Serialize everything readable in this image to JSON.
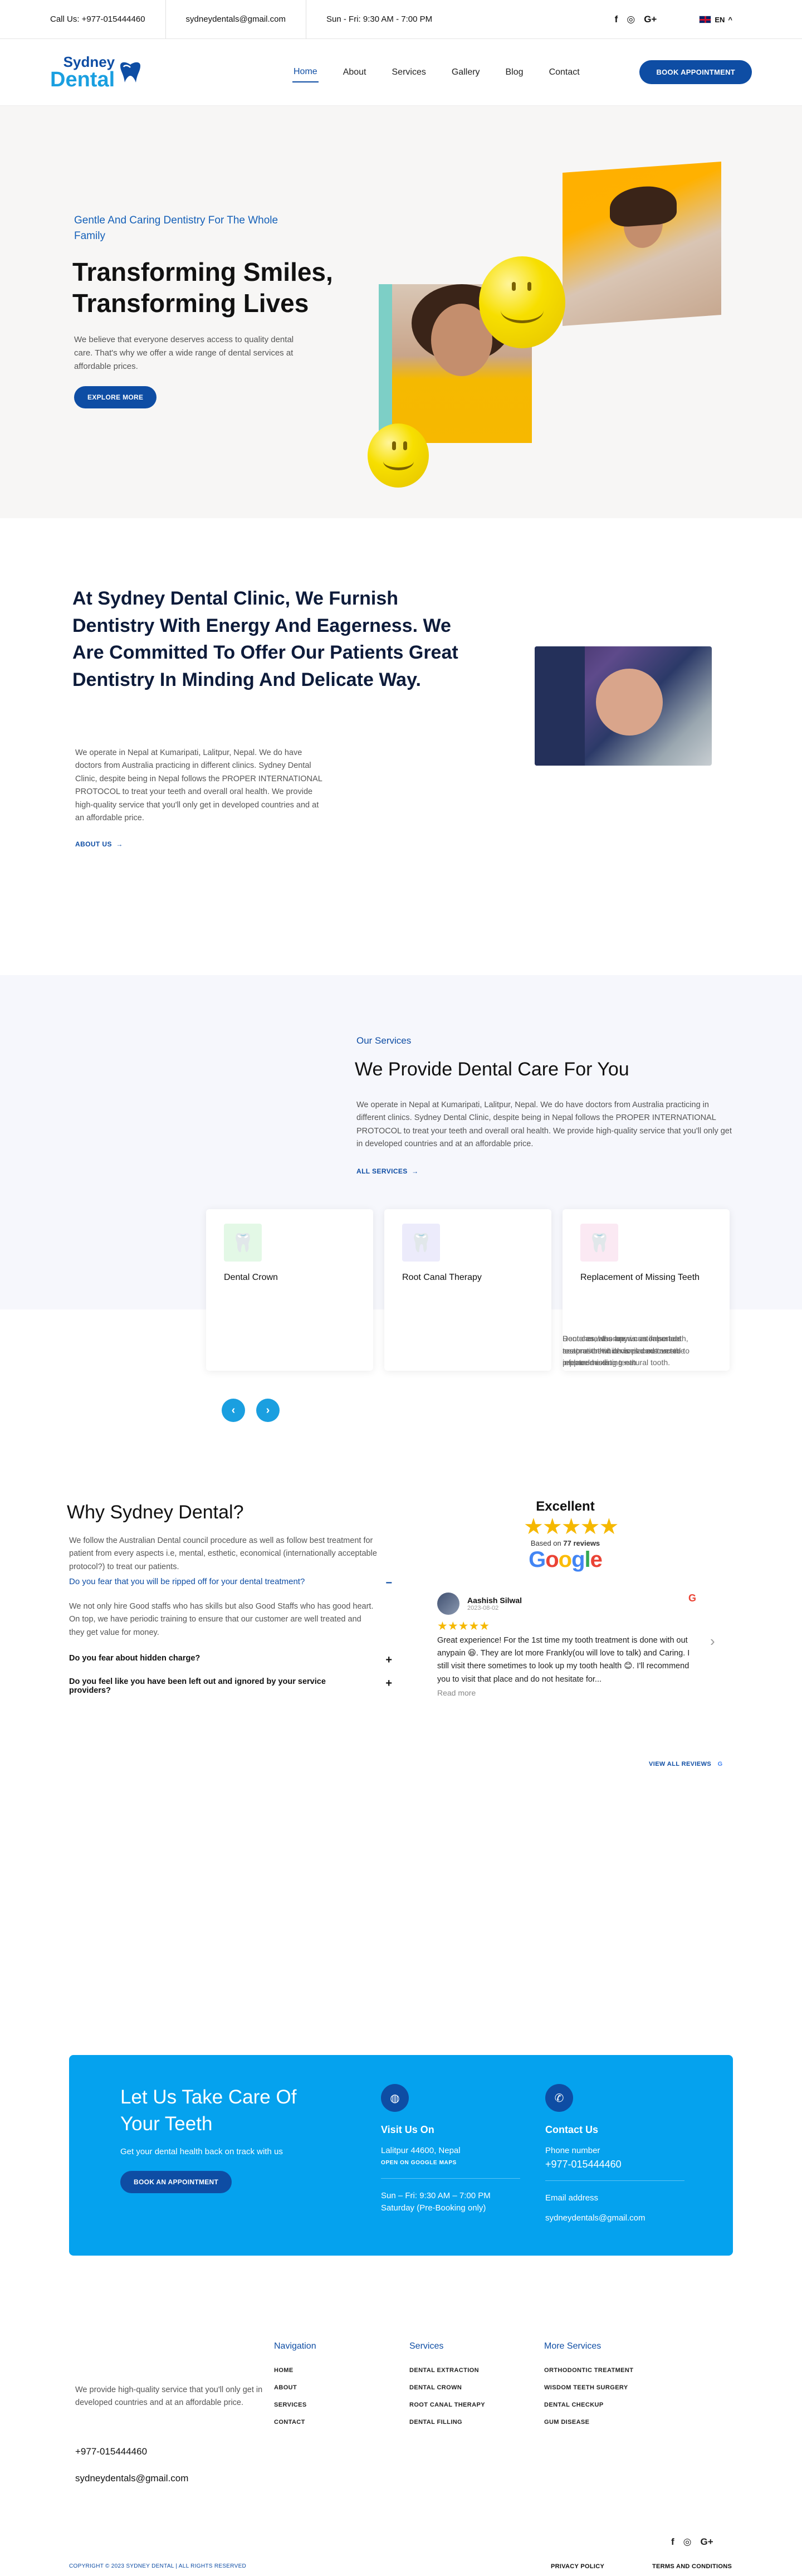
{
  "topbar": {
    "call": "Call Us: +977-015444460",
    "email": "sydneydentals@gmail.com",
    "hours": "Sun - Fri: 9:30 AM - 7:00 PM",
    "social": [
      "f",
      "◎",
      "G+"
    ],
    "language": "EN"
  },
  "header": {
    "logo_line1": "Sydney",
    "logo_line2": "Dental",
    "nav": [
      "Home",
      "About",
      "Services",
      "Gallery",
      "Blog",
      "Contact"
    ],
    "book_button": "BOOK APPOINTMENT"
  },
  "hero": {
    "tagline": "Gentle And Caring Dentistry For The Whole Family",
    "title": "Transforming Smiles, Transforming Lives",
    "description": "We believe that everyone deserves access to quality dental care. That's why we offer a wide range of dental services at affordable prices.",
    "button": "EXPLORE MORE"
  },
  "about": {
    "title": "At Sydney Dental Clinic, We Furnish Dentistry With Energy And Eagerness. We Are Committed To Offer Our Patients Great Dentistry In Minding And Delicate Way.",
    "text": "We operate in Nepal at Kumaripati, Lalitpur, Nepal. We do have doctors from Australia practicing in different clinics. Sydney Dental Clinic, despite being in Nepal follows the PROPER INTERNATIONAL PROTOCOL to treat your teeth and overall oral health. We provide high-quality service that you'll only get in developed countries and at an affordable price.",
    "link": "ABOUT US"
  },
  "services": {
    "kicker": "Our Services",
    "title": "We Provide Dental Care For You",
    "text": "We operate in Nepal at Kumaripati, Lalitpur, Nepal. We do have doctors from Australia practicing in different clinics. Sydney Dental Clinic, despite being in Nepal follows the PROPER INTERNATIONAL PROTOCOL to treat your teeth and overall oral health. We provide high-quality service that you'll only get in developed countries and at an affordable price.",
    "link": "ALL SERVICES",
    "cards": [
      {
        "title": "Dental Crown",
        "text": "Dental crowns are a custom-made restoration which is placed over the prepared existing natural tooth.",
        "icon": "crown-tooth-icon",
        "bg": "#e3f8e6"
      },
      {
        "title": "Root Canal Therapy",
        "text": "Root canal therapy is an important treatment that is carried out on an infected tooth.",
        "icon": "root-canal-icon",
        "bg": "#ecebfb"
      },
      {
        "title": "Replacement of Missing Teeth",
        "text": "Dentures, also known as false teeth, are prosthetic devices constructed to replace missing teeth",
        "icon": "denture-icon",
        "bg": "#fbe9f3"
      }
    ]
  },
  "why": {
    "title": "Why Sydney Dental?",
    "intro": "We follow the Australian Dental council procedure as well as follow best treatment for patient from every aspects i.e, mental, esthetic, economical (internationally acceptable protocol?) to treat our patients.",
    "faqs": [
      {
        "q": "Do you fear that you will be ripped off for your dental treatment?",
        "sign": "−"
      },
      {
        "q": "Do you fear about hidden charge?",
        "sign": "+"
      },
      {
        "q": "Do you feel like you have been left out and ignored by your service providers?",
        "sign": "+"
      }
    ],
    "answer": "We not only hire Good staffs who has skills but also Good Staffs who has good heart. On top, we have periodic training to ensure that our customer are well treated and they get value for money."
  },
  "reviews": {
    "label": "Excellent",
    "based_on_prefix": "Based on",
    "count": "77 reviews",
    "brand": "Google",
    "reviewer": "Aashish Silwal",
    "date": "2023-08-02",
    "text": "Great experience! For the 1st time my tooth treatment is done with out anypain 😆. They are lot more Frankly(ou will love to talk) and Caring. I still visit there sometimes to look up my tooth health 😊. I'll recommend you to visit that place and do not hesitate for...",
    "read_more": "Read more",
    "view_all": "VIEW ALL REVIEWS"
  },
  "cta": {
    "title": "Let Us Take Care Of Your Teeth",
    "subtitle": "Get your dental health back on track with us",
    "button": "BOOK AN APPOINTMENT",
    "visit_title": "Visit Us On",
    "address": "Lalitpur 44600, Nepal",
    "maps_link": "OPEN ON GOOGLE MAPS",
    "hours1": "Sun – Fri: 9:30 AM – 7:00 PM",
    "hours2": "Saturday (Pre-Booking only)",
    "contact_title": "Contact Us",
    "phone_label": "Phone number",
    "phone": "+977-015444460",
    "email_label": "Email address",
    "email": "sydneydentals@gmail.com"
  },
  "footer": {
    "description": "We provide high-quality service that you'll only get in developed countries and at an affordable price.",
    "phone": "+977-015444460",
    "email": "sydneydentals@gmail.com",
    "navigation_title": "Navigation",
    "navigation": [
      "HOME",
      "ABOUT",
      "SERVICES",
      "CONTACT"
    ],
    "services_title": "Services",
    "services": [
      "DENTAL EXTRACTION",
      "DENTAL CROWN",
      "ROOT CANAL THERAPY",
      "DENTAL FILLING"
    ],
    "more_title": "More Services",
    "more": [
      "ORTHODONTIC TREATMENT",
      "WISDOM TEETH SURGERY",
      "DENTAL CHECKUP",
      "GUM DISEASE"
    ],
    "copyright": "COPYRIGHT © 2023 SYDNEY DENTAL | ALL RIGHTS RESERVED",
    "privacy": "PRIVACY POLICY",
    "terms": "TERMS AND CONDITIONS"
  },
  "colors": {
    "primary": "#0e4da4",
    "accent": "#05a2ee",
    "hero_bg": "#f7f6f5",
    "services_bg": "#f6f7fc"
  }
}
